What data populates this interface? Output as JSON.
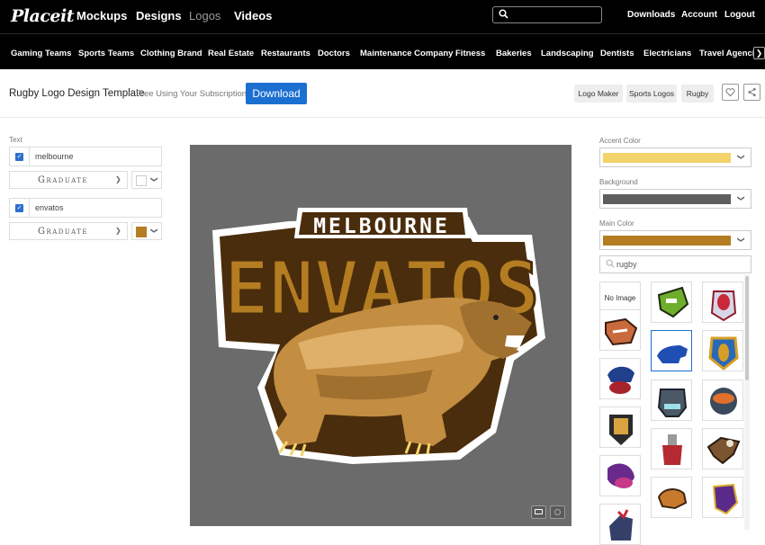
{
  "header": {
    "logo": "Placeit",
    "nav": [
      "Mockups",
      "Designs",
      "Logos",
      "Videos"
    ],
    "search_value": "",
    "right_links": [
      "Downloads",
      "Account",
      "Logout"
    ]
  },
  "categories": [
    "Gaming Teams",
    "Sports Teams",
    "Clothing Brand",
    "Real Estate",
    "Restaurants",
    "Doctors",
    "Maintenance Company",
    "Fitness",
    "Bakeries",
    "Landscaping",
    "Dentists",
    "Electricians",
    "Travel Agencie"
  ],
  "title_row": {
    "title": "Rugby Logo Design Template",
    "subtitle": "Free Using Your Subscription!",
    "download": "Download",
    "tags": [
      "Logo Maker",
      "Sports Logos",
      "Rugby"
    ]
  },
  "left_panel": {
    "section_label": "Text",
    "fields": [
      {
        "value": "melbourne",
        "font": "Graduate",
        "color": "#ffffff"
      },
      {
        "value": "envatos",
        "font": "Graduate",
        "color": "#b47d22"
      }
    ]
  },
  "logo_art": {
    "line1": "MELBOURNE",
    "line2": "ENVATOS"
  },
  "right_panel": {
    "accent_label": "Accent Color",
    "accent_color": "#f2d46a",
    "background_label": "Background",
    "background_color": "#5e5e5e",
    "main_label": "Main Color",
    "main_color": "#b47d22",
    "search_value": "rugby",
    "no_image": "No Image"
  },
  "colors": {
    "brand_blue": "#1b6fd1",
    "canvas_bg": "#6b6b6b"
  }
}
